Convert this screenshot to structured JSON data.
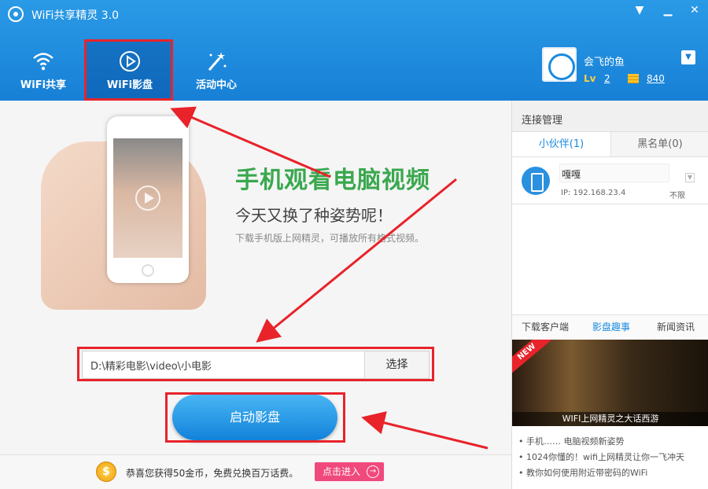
{
  "window": {
    "title": "WiFi共享精灵 3.0",
    "min_icon": "▁",
    "menu_icon": "▼",
    "close_icon": "✕"
  },
  "nav": {
    "tabs": [
      {
        "label": "WiFi共享",
        "icon": "wifi-icon"
      },
      {
        "label": "WiFi影盘",
        "icon": "play-circle-icon"
      },
      {
        "label": "活动中心",
        "icon": "magic-wand-icon"
      }
    ],
    "active_index": 1
  },
  "user": {
    "name": "会飞的鱼",
    "level_icon": "Lv",
    "level": "2",
    "coins": "840",
    "dropdown": "▼"
  },
  "main": {
    "headline": "手机观看电脑视频",
    "subline": "今天又换了种姿势呢！",
    "description": "下载手机版上网精灵，可播放所有格式视频。",
    "path_value": "D:\\精彩电影\\video\\小电影",
    "choose_label": "选择",
    "start_label": "启动影盘"
  },
  "right": {
    "title": "连接管理",
    "tab_friends": "小伙伴(1)",
    "tab_blacklist": "黑名单(0)",
    "device": {
      "name": "嘎嘎",
      "ip": "IP: 192.168.23.4",
      "limit": "不限"
    },
    "news_tabs": [
      "下载客户端",
      "影盘趣事",
      "新闻资讯"
    ],
    "news_active": 1,
    "banner_badge": "NEW",
    "banner_caption": "WIFI上网精灵之大话西游",
    "news_items": [
      "• 手机…… 电脑视频新姿势",
      "• 1024你懂的！wifi上网精灵让你一飞冲天",
      "• 教你如何使用附近带密码的WiFi"
    ]
  },
  "bottom": {
    "coin_symbol": "$",
    "message": "恭喜您获得50金币，免费兑换百万话费。",
    "enter_label": "点击进入",
    "enter_arrow": "→"
  },
  "colors": {
    "header_blue": "#1780d6",
    "accent_blue": "#1a8ae0",
    "headline_green": "#3aa84e",
    "highlight_red": "#e8232a",
    "enter_pink": "#f0497c"
  }
}
